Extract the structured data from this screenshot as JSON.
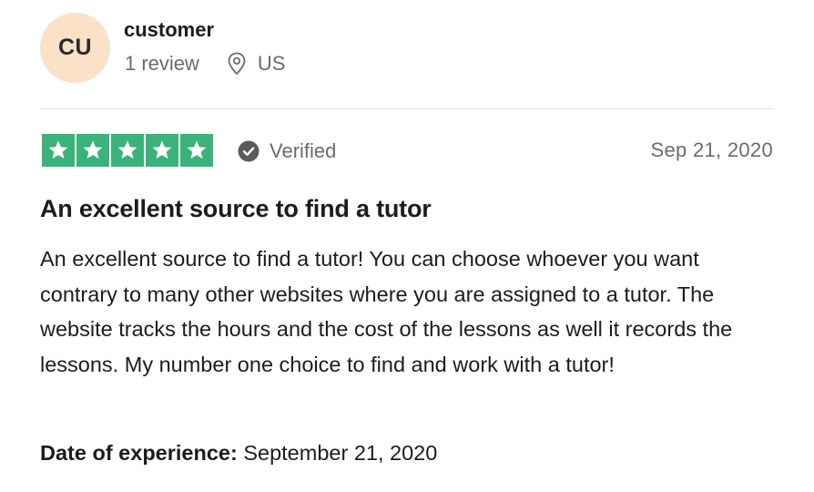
{
  "reviewer": {
    "initials": "CU",
    "name": "customer",
    "review_count": "1 review",
    "location": "US",
    "location_icon": "map-pin-icon"
  },
  "rating": {
    "stars": 5,
    "max_stars": 5,
    "star_color": "#3bb27b",
    "verified_label": "Verified",
    "verified_icon": "check-circle-icon"
  },
  "review": {
    "date": "Sep 21, 2020",
    "title": "An excellent source to find a tutor",
    "body": "An excellent source to find a tutor! You can choose whoever you want contrary to many other websites where you are assigned to a tutor. The website tracks the hours and the cost of the lessons as well it records the lessons. My number one choice to find and work with a tutor!"
  },
  "experience": {
    "label": "Date of experience:",
    "value": "September 21, 2020"
  },
  "colors": {
    "avatar_bg": "#fae1c8",
    "muted_text": "#6b6b6b",
    "divider": "#e2e2e2"
  }
}
